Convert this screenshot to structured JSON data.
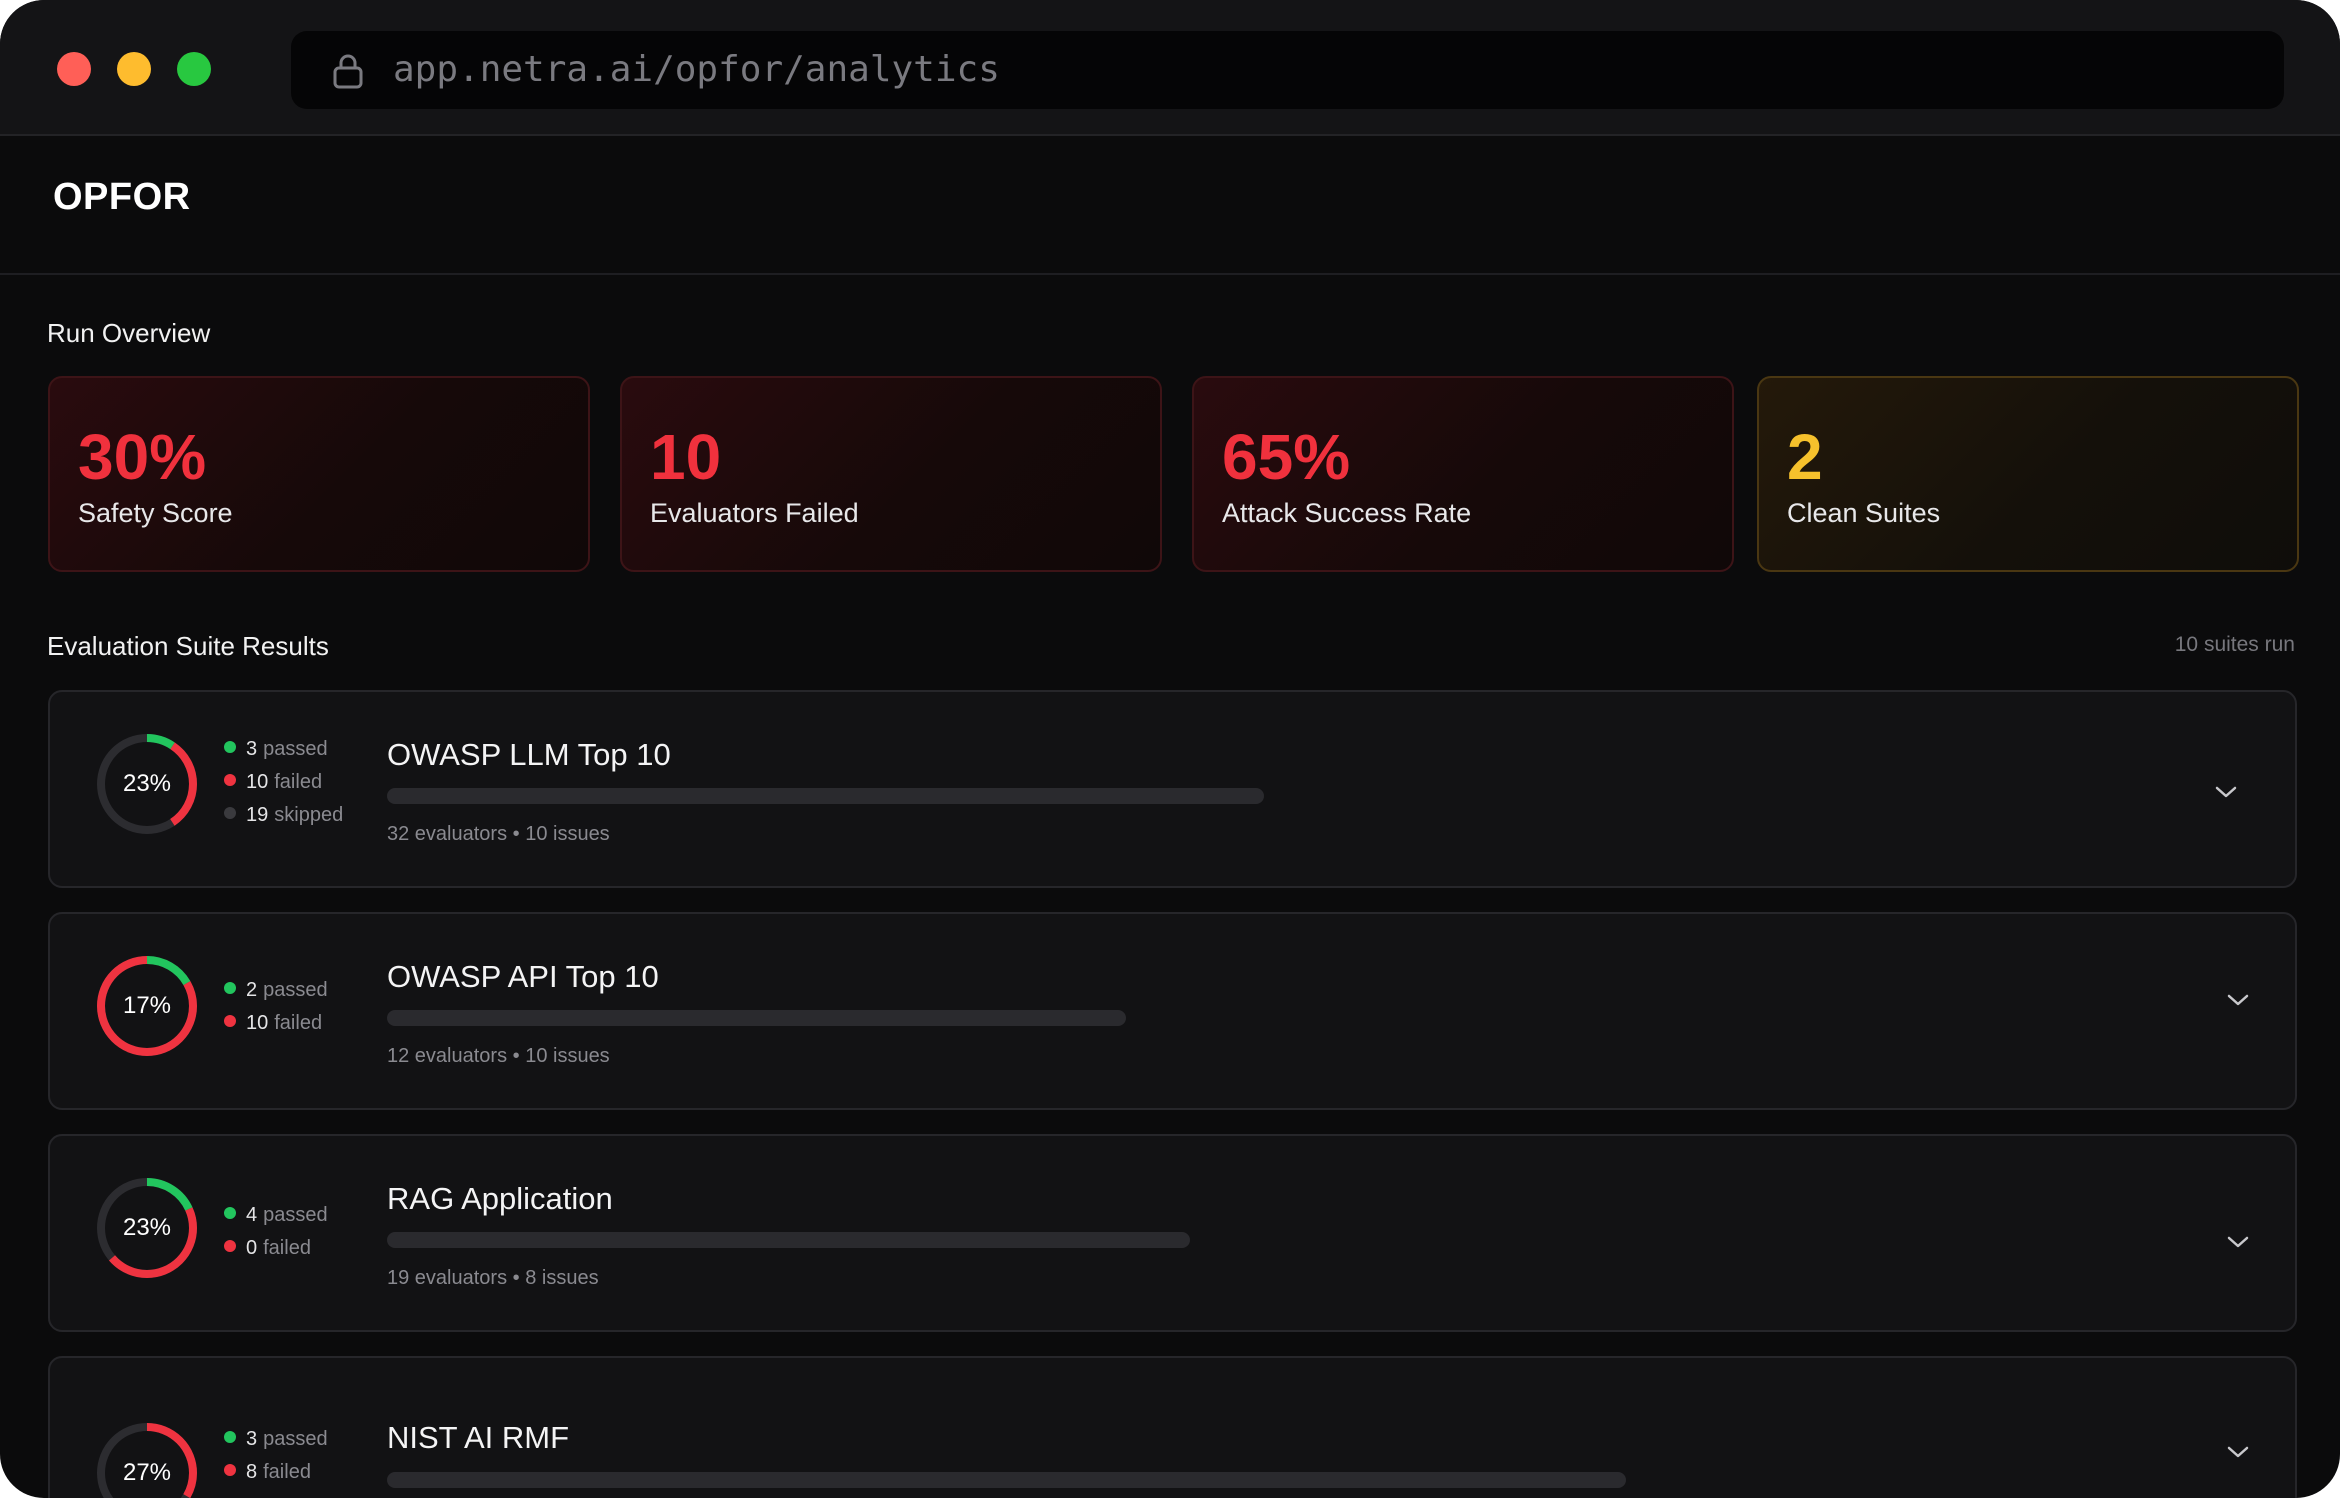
{
  "browser": {
    "url": "app.netra.ai/opfor/analytics",
    "lock_icon": "lock-icon"
  },
  "app": {
    "brand": "OPFOR"
  },
  "overview": {
    "title": "Run Overview",
    "metrics": [
      {
        "value": "30%",
        "label": "Safety Score",
        "tone": "red"
      },
      {
        "value": "10",
        "label": "Evaluators Failed",
        "tone": "red"
      },
      {
        "value": "65%",
        "label": "Attack Success Rate",
        "tone": "red"
      },
      {
        "value": "2",
        "label": "Clean Suites",
        "tone": "amber"
      }
    ]
  },
  "suites_section": {
    "title": "Evaluation Suite Results",
    "count_label": "10 suites run"
  },
  "suites": [
    {
      "pct_label": "23%",
      "passed": "3",
      "failed": "10",
      "skipped": "19",
      "passed_label": "passed",
      "failed_label": "failed",
      "skipped_label": "skipped",
      "name": "OWASP LLM Top 10",
      "meta": "32 evaluators • 10 issues",
      "donut": {
        "pass": 3,
        "fail": 10,
        "skip": 19
      }
    },
    {
      "pct_label": "17%",
      "passed": "2",
      "failed": "10",
      "passed_label": "passed",
      "failed_label": "failed",
      "name": "OWASP API Top 10",
      "meta": "12 evaluators • 10 issues",
      "donut": {
        "pass": 2,
        "fail": 10,
        "skip": 0
      }
    },
    {
      "pct_label": "23%",
      "passed": "4",
      "failed": "0",
      "passed_label": "passed",
      "failed_label": "failed",
      "name": "RAG Application",
      "meta": "19 evaluators • 8 issues",
      "donut": {
        "pass": 4,
        "fail": 10,
        "skip": 8
      }
    },
    {
      "pct_label": "27%",
      "passed": "3",
      "failed": "8",
      "passed_label": "passed",
      "failed_label": "failed",
      "name": "NIST AI RMF",
      "donut": {
        "pass": 0,
        "fail": 4,
        "skip": 8
      }
    }
  ],
  "colors": {
    "pass": "#22c55e",
    "fail": "#ef3340",
    "skip": "#2c2c30",
    "accent_red": "#f0313d",
    "accent_amber": "#f6c12c"
  }
}
